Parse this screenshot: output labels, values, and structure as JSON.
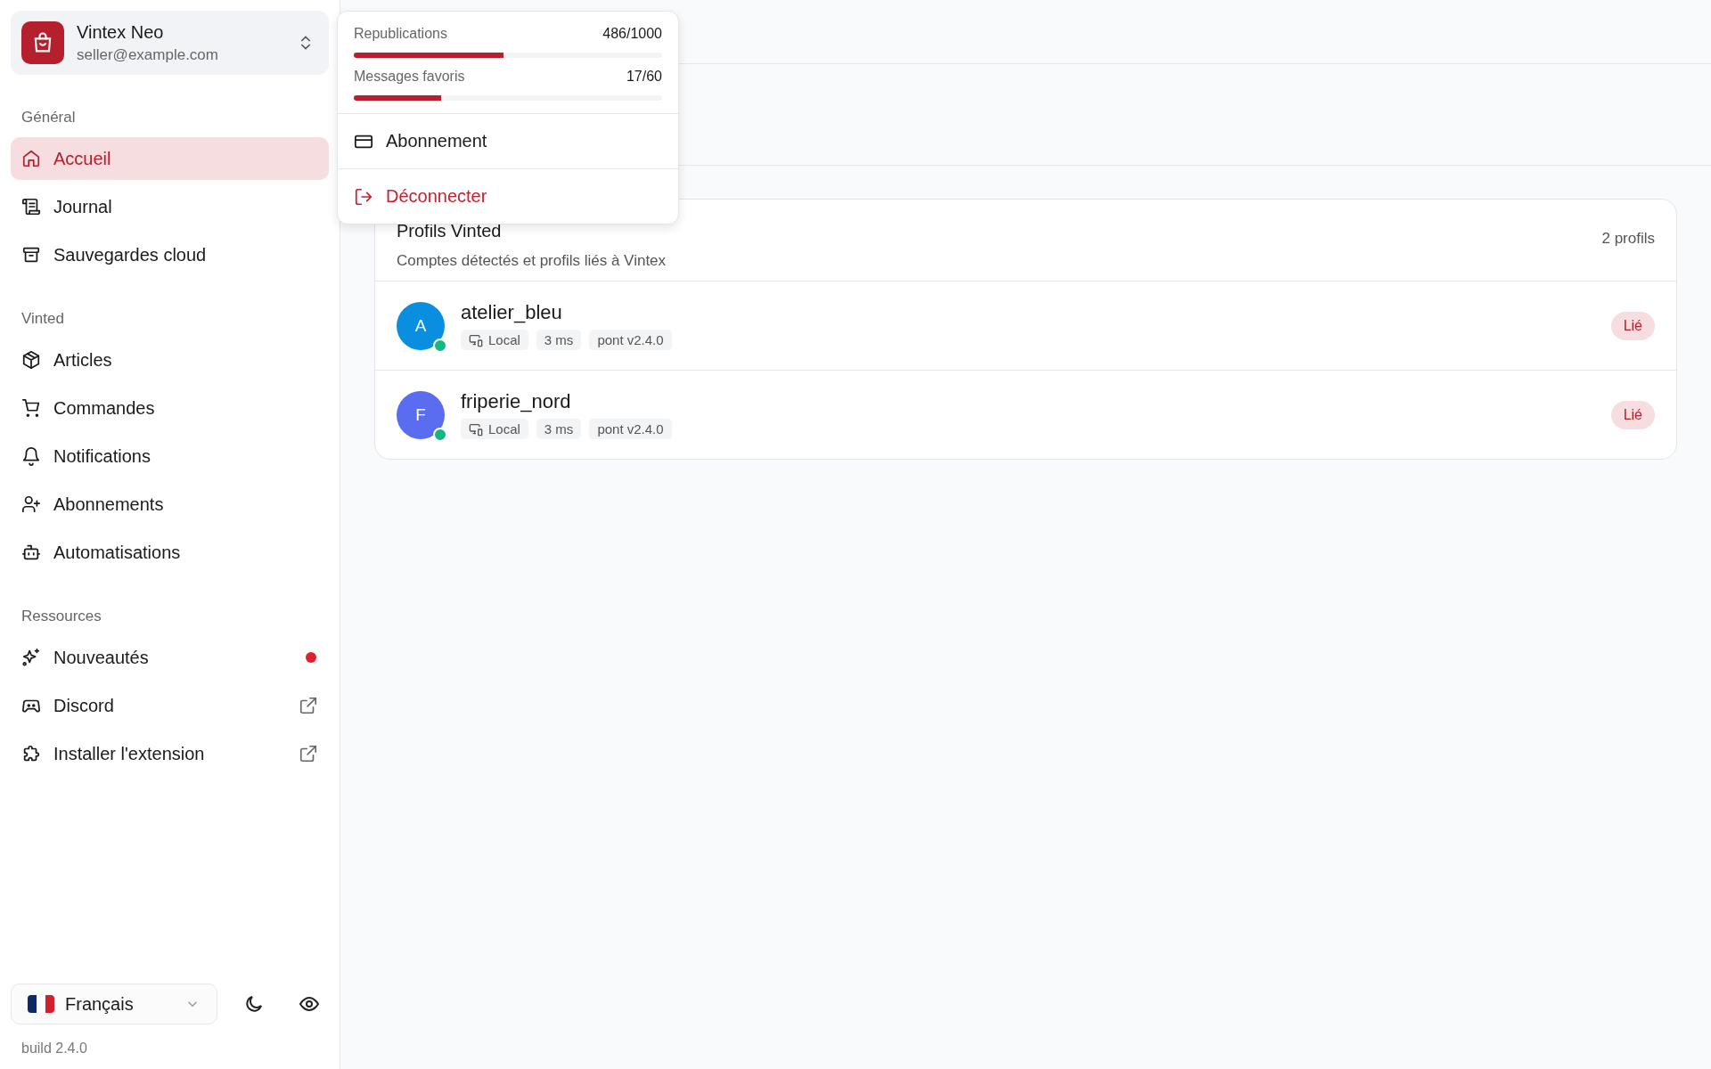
{
  "account": {
    "name": "Vintex Neo",
    "email": "seller@example.com"
  },
  "menu": {
    "usage": [
      {
        "label": "Republications",
        "count": "486/1000",
        "level": 0.486
      },
      {
        "label": "Messages favoris",
        "count": "17/60",
        "level": 0.283
      }
    ],
    "items": [
      {
        "label": "Abonnement",
        "kind": "normal"
      },
      {
        "label": "Déconnecter",
        "kind": "danger"
      }
    ]
  },
  "sidebar": {
    "sections": [
      {
        "title": "Général",
        "items": [
          {
            "label": "Accueil",
            "selected": true
          },
          {
            "label": "Journal",
            "selected": false
          },
          {
            "label": "Sauvegardes cloud",
            "selected": false
          }
        ]
      },
      {
        "title": "Vinted",
        "items": [
          {
            "label": "Articles",
            "selected": false
          },
          {
            "label": "Commandes",
            "selected": false
          },
          {
            "label": "Notifications",
            "selected": false
          },
          {
            "label": "Abonnements",
            "selected": false
          },
          {
            "label": "Automatisations",
            "selected": false
          }
        ]
      },
      {
        "title": "Ressources",
        "items": [
          {
            "label": "Nouveautés",
            "selected": false,
            "kind": "dot"
          },
          {
            "label": "Discord",
            "selected": false,
            "kind": "external"
          },
          {
            "label": "Installer l'extension",
            "selected": false,
            "kind": "external"
          }
        ]
      }
    ],
    "language": "Français",
    "build": "build 2.4.0"
  },
  "profiles": {
    "title": "Profils Vinted",
    "subtitle": "Comptes détectés et profils liés à Vintex",
    "count": "2 profils",
    "rows": [
      {
        "initial": "A",
        "name": "atelier_bleu",
        "color": "#0a8ee0",
        "online": true,
        "tags": [
          "Local",
          "3 ms",
          "pont v2.4.0"
        ],
        "status": "Lié"
      },
      {
        "initial": "F",
        "name": "friperie_nord",
        "color": "#5a6cf0",
        "online": true,
        "tags": [
          "Local",
          "3 ms",
          "pont v2.4.0"
        ],
        "status": "Lié"
      }
    ]
  }
}
